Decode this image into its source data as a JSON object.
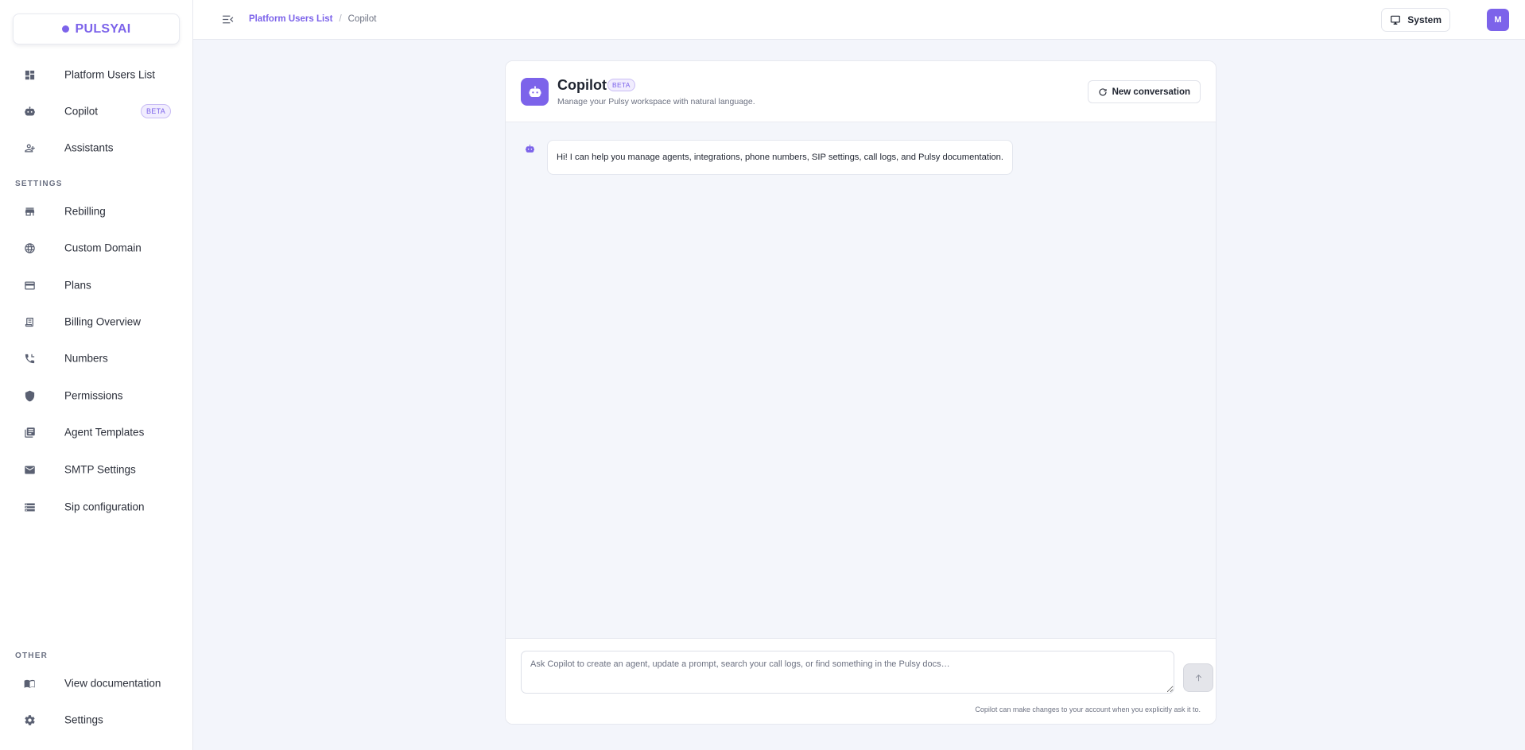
{
  "brand": {
    "name": "PULSYAI",
    "accent": "#7c63ea"
  },
  "sidebar": {
    "main_items": [
      {
        "label": "Platform Users List",
        "icon": "dashboard-icon"
      },
      {
        "label": "Copilot",
        "icon": "robot-icon",
        "badge": "BETA"
      },
      {
        "label": "Assistants",
        "icon": "person-add-icon"
      }
    ],
    "settings_heading": "SETTINGS",
    "settings_items": [
      {
        "label": "Rebilling",
        "icon": "store-icon"
      },
      {
        "label": "Custom Domain",
        "icon": "globe-icon"
      },
      {
        "label": "Plans",
        "icon": "credit-card-icon"
      },
      {
        "label": "Billing Overview",
        "icon": "receipt-icon"
      },
      {
        "label": "Numbers",
        "icon": "phone-icon"
      },
      {
        "label": "Permissions",
        "icon": "shield-icon"
      },
      {
        "label": "Agent Templates",
        "icon": "library-icon"
      },
      {
        "label": "SMTP Settings",
        "icon": "mail-icon"
      },
      {
        "label": "Sip configuration",
        "icon": "server-icon"
      }
    ],
    "other_heading": "OTHER",
    "other_items": [
      {
        "label": "View documentation",
        "icon": "book-icon"
      },
      {
        "label": "Settings",
        "icon": "gear-icon"
      }
    ]
  },
  "topbar": {
    "breadcrumb": {
      "parent": "Platform Users List",
      "separator": "/",
      "current": "Copilot"
    },
    "theme_label": "System",
    "avatar_initial": "M"
  },
  "copilot": {
    "title": "Copilot",
    "title_badge": "BETA",
    "subtitle": "Manage your Pulsy workspace with natural language.",
    "new_conversation_label": "New conversation",
    "messages": [
      {
        "role": "assistant",
        "text": "Hi! I can help you manage agents, integrations, phone numbers, SIP settings, call logs, and Pulsy documentation."
      }
    ],
    "input_placeholder": "Ask Copilot to create an agent, update a prompt, search your call logs, or find something in the Pulsy docs…",
    "disclaimer": "Copilot can make changes to your account when you explicitly ask it to."
  }
}
